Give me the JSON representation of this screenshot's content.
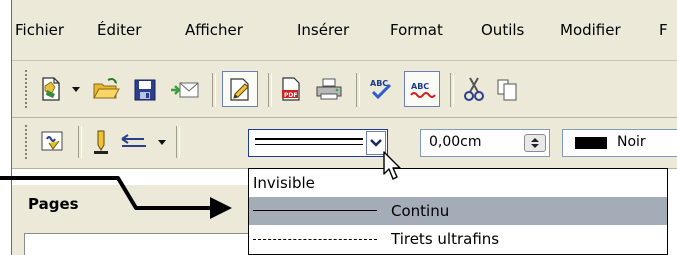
{
  "menubar": {
    "items": [
      {
        "label": "Fichier"
      },
      {
        "label": "Éditer"
      },
      {
        "label": "Afficher"
      },
      {
        "label": "Insérer"
      },
      {
        "label": "Format"
      },
      {
        "label": "Outils"
      },
      {
        "label": "Modifier"
      },
      {
        "label": "F"
      }
    ]
  },
  "line_toolbar": {
    "width_value": "0,00cm",
    "color_label": "Noir",
    "color_value": "#000000"
  },
  "line_style_dropdown": {
    "options": [
      {
        "label": "Invisible",
        "selected": false
      },
      {
        "label": "Continu",
        "selected": true
      },
      {
        "label": "Tirets ultrafins",
        "selected": false
      }
    ],
    "selected_color": "#a3acb7"
  },
  "pages_panel": {
    "title": "Pages"
  }
}
